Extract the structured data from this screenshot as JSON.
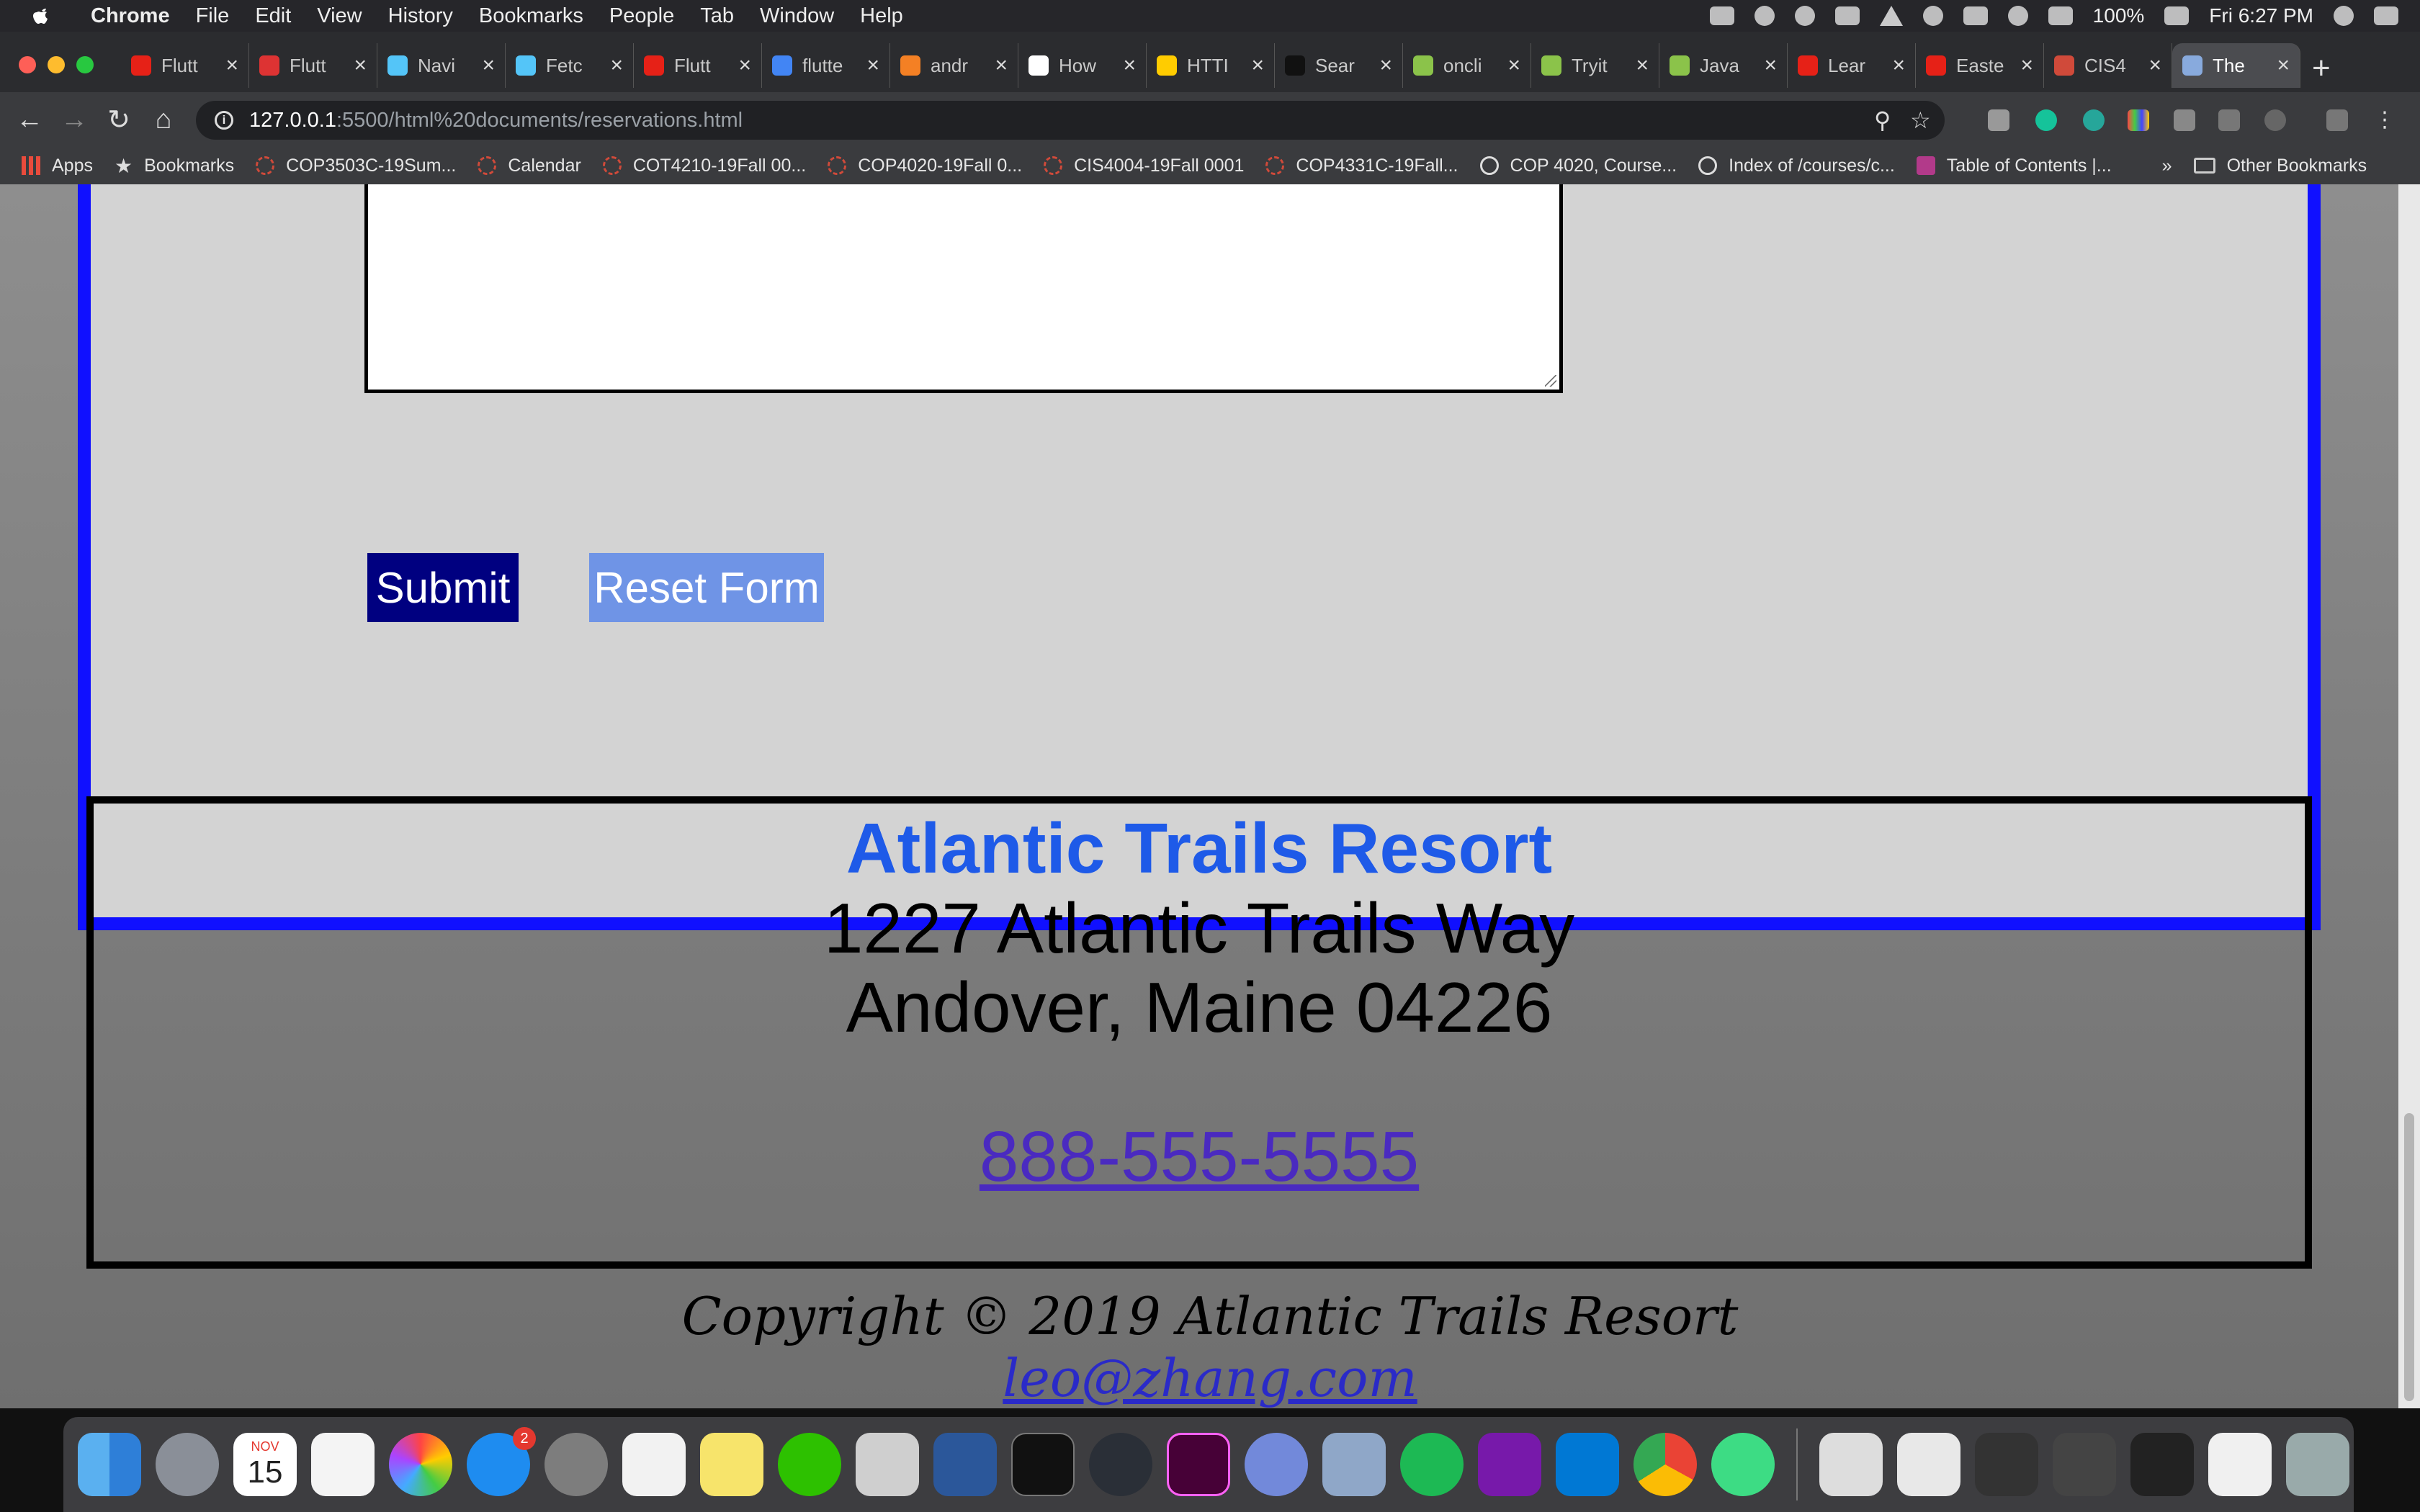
{
  "menubar": {
    "app_name": "Chrome",
    "items": [
      "File",
      "Edit",
      "View",
      "History",
      "Bookmarks",
      "People",
      "Tab",
      "Window",
      "Help"
    ],
    "battery": "100%",
    "clock": "Fri 6:27 PM"
  },
  "tabs": [
    {
      "title": "Flutt",
      "color": "#e62117"
    },
    {
      "title": "Flutt",
      "color": "#d33"
    },
    {
      "title": "Navi",
      "color": "#54c5f8"
    },
    {
      "title": "Fetc",
      "color": "#54c5f8"
    },
    {
      "title": "Flutt",
      "color": "#e62117"
    },
    {
      "title": "flutte",
      "color": "#4285f4"
    },
    {
      "title": "andr",
      "color": "#f48024"
    },
    {
      "title": "How",
      "color": "#ffffff"
    },
    {
      "title": "HTTI",
      "color": "#ffcc00"
    },
    {
      "title": "Sear",
      "color": "#111111"
    },
    {
      "title": "oncli",
      "color": "#8bc34a"
    },
    {
      "title": "Tryit",
      "color": "#8bc34a"
    },
    {
      "title": "Java",
      "color": "#8bc34a"
    },
    {
      "title": "Lear",
      "color": "#e62117"
    },
    {
      "title": "Easte",
      "color": "#e62117"
    },
    {
      "title": "CIS4",
      "color": "#d04a3a"
    },
    {
      "title": "The",
      "color": "#88aadd"
    }
  ],
  "toolbar": {
    "url_host": "127.0.0.1",
    "url_path": ":5500/html%20documents/reservations.html"
  },
  "bookmarks": [
    {
      "label": "Apps",
      "icon": "apps-grid-icon"
    },
    {
      "label": "Bookmarks",
      "icon": "star-icon"
    },
    {
      "label": "COP3503C-19Sum...",
      "icon": "webcourses-icon"
    },
    {
      "label": "Calendar",
      "icon": "webcourses-icon"
    },
    {
      "label": "COT4210-19Fall 00...",
      "icon": "webcourses-icon"
    },
    {
      "label": "COP4020-19Fall 0...",
      "icon": "webcourses-icon"
    },
    {
      "label": "CIS4004-19Fall 0001",
      "icon": "webcourses-icon"
    },
    {
      "label": "COP4331C-19Fall...",
      "icon": "webcourses-icon"
    },
    {
      "label": "COP 4020, Course...",
      "icon": "globe-icon"
    },
    {
      "label": "Index of /courses/c...",
      "icon": "globe-icon"
    },
    {
      "label": "Table of Contents |...",
      "icon": "book-icon"
    }
  ],
  "bookmarks_more": "»",
  "bookmarks_other": "Other Bookmarks",
  "form": {
    "submit_label": "Submit",
    "reset_label": "Reset Form"
  },
  "footer": {
    "resort_name": "Atlantic Trails Resort",
    "address_line1": "1227 Atlantic Trails Way",
    "address_line2": "Andover, Maine 04226",
    "phone": "888-555-5555",
    "copyright": "Copyright © 2019 Atlantic Trails Resort",
    "email": "leo@zhang.com"
  },
  "dock": {
    "calendar_month": "NOV",
    "calendar_day": "15",
    "appstore_badge": "2"
  }
}
